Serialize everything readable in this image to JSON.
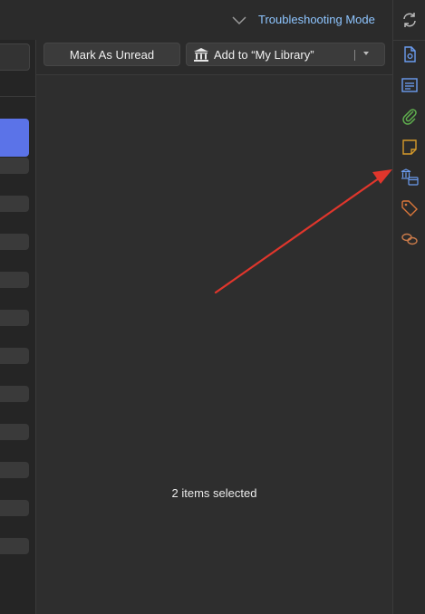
{
  "header": {
    "troubleshooting_label": "Troubleshooting Mode"
  },
  "toolbar": {
    "mark_unread_label": "Mark As Unread",
    "add_to_library_label": "Add to “My Library”"
  },
  "main": {
    "selection_status": "2 items selected"
  },
  "sidenav": {
    "items": [
      {
        "icon": "info-icon"
      },
      {
        "icon": "abstract-icon"
      },
      {
        "icon": "attachments-icon"
      },
      {
        "icon": "notes-icon"
      },
      {
        "icon": "libraries-collections-icon"
      },
      {
        "icon": "tags-icon"
      },
      {
        "icon": "related-icon"
      }
    ]
  },
  "colors": {
    "accent": "#8ec5ff",
    "selection": "#5b73e8",
    "annotation_arrow": "#e0362c"
  }
}
